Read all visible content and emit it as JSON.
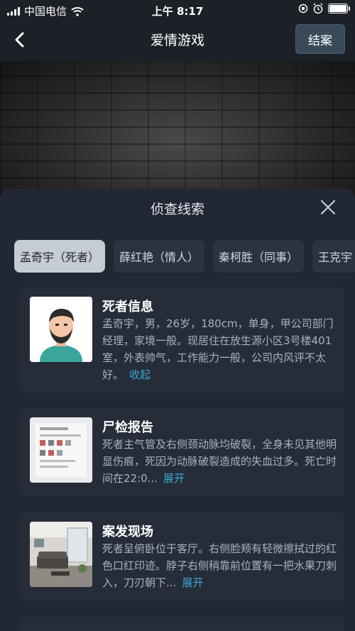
{
  "status_bar": {
    "carrier": "中国电信",
    "time": "上午 8:17"
  },
  "nav": {
    "title": "爱情游戏",
    "close_case_label": "结案"
  },
  "sheet": {
    "title": "侦查线索",
    "tabs": [
      {
        "label": "孟奇宇（死者）",
        "active": true
      },
      {
        "label": "薛红艳（情人）",
        "active": false
      },
      {
        "label": "秦柯胜（同事）",
        "active": false
      },
      {
        "label": "王克宇",
        "active": false
      }
    ],
    "cards": [
      {
        "title": "死者信息",
        "body": "孟奇宇，男，26岁，180cm，单身，甲公司部门经理，家境一般。现居住在放生源小区3号楼401室，外表帅气，工作能力一般，公司内风评不太好。",
        "toggle": "收起",
        "thumb_icon": "avatar-icon"
      },
      {
        "title": "尸检报告",
        "body": "死者主气管及右侧颈动脉均破裂，全身未见其他明显伤痕，死因为动脉破裂造成的失血过多。死亡时间在22:0...",
        "toggle": "展开",
        "thumb_icon": "report-document-icon"
      },
      {
        "title": "案发现场",
        "body": "死者呈俯卧位于客厅。右侧脸颊有轻微擦拭过的红色口红印迹。脖子右侧稍靠前位置有一把水果刀刺入，刀刃朝下...",
        "toggle": "展开",
        "thumb_icon": "living-room-photo-icon"
      }
    ]
  },
  "colors": {
    "background": "#1c2027",
    "sheet": "#212733",
    "card": "#262d39",
    "accent_link": "#3aa9d6",
    "active_tab": "#c6ccd4"
  }
}
